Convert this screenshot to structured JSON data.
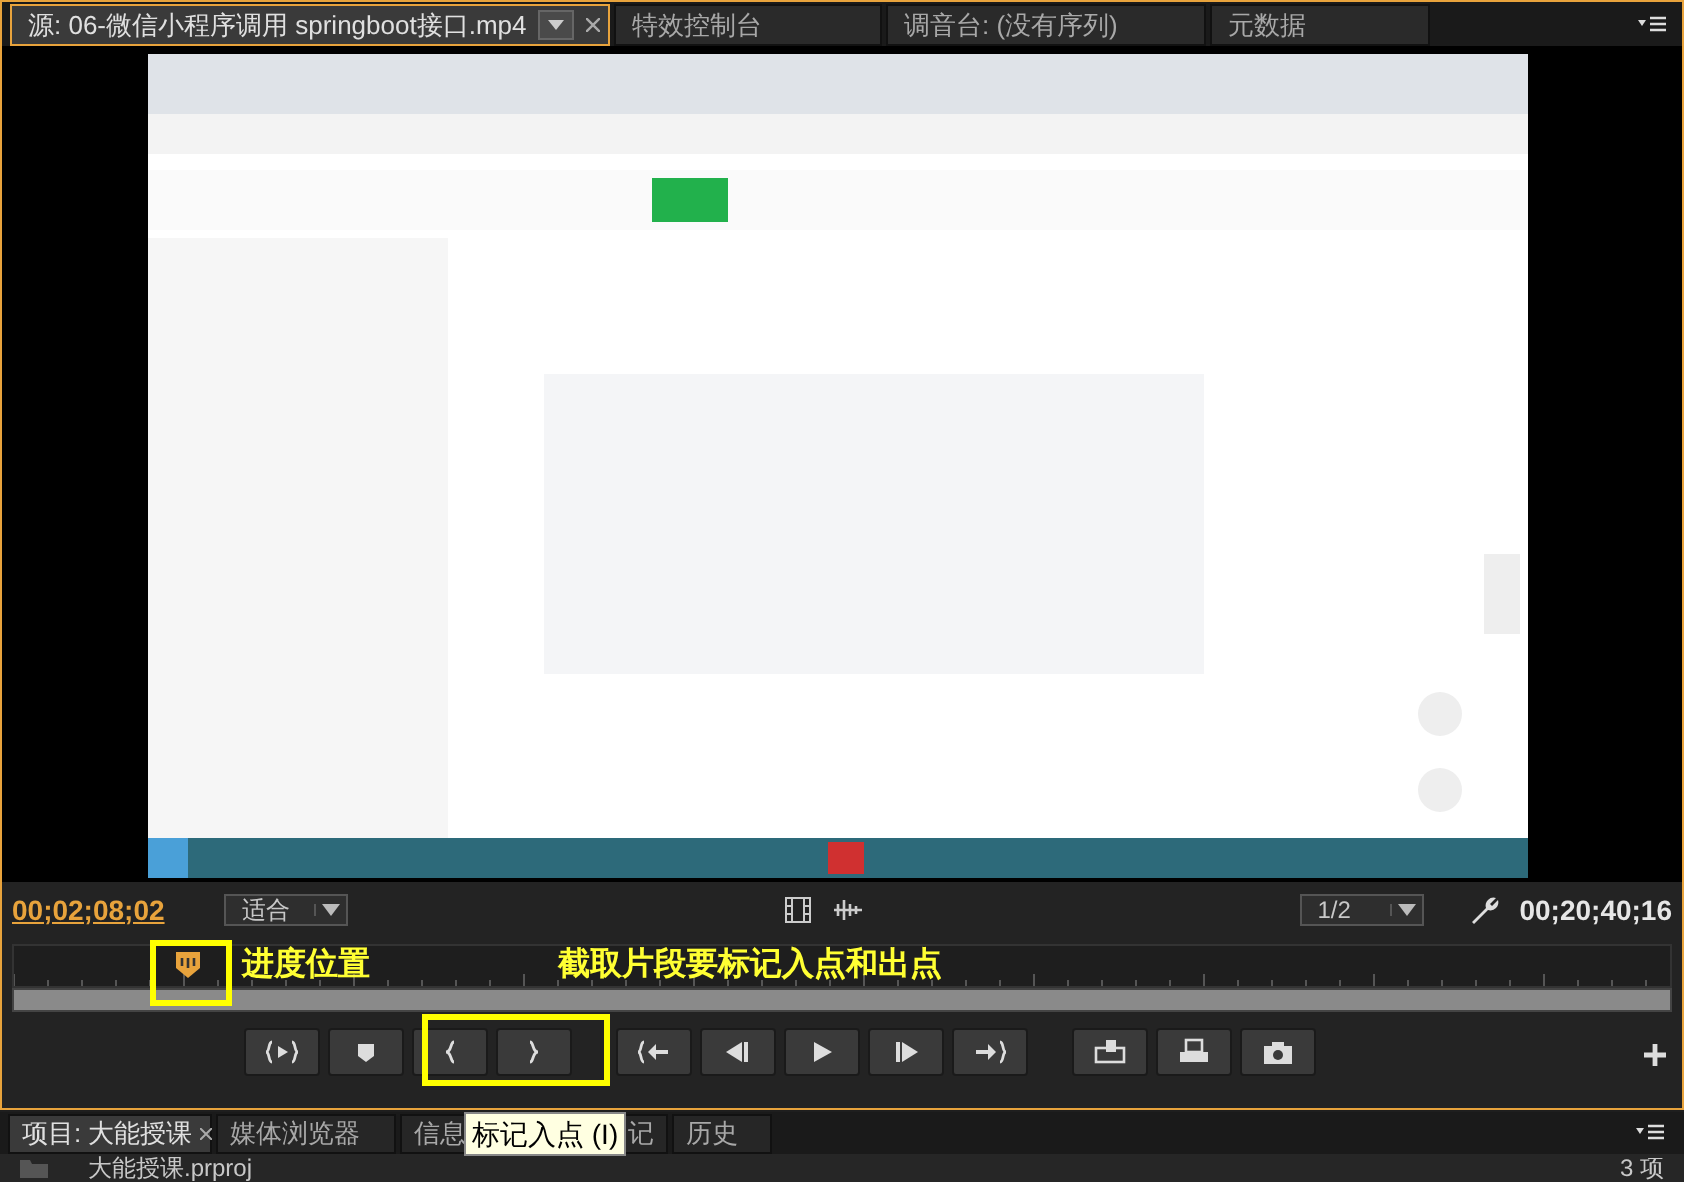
{
  "source_tabs": [
    {
      "label": "源: 06-微信小程序调用 springboot接口.mp4",
      "selected": true,
      "kind": "dropdown"
    },
    {
      "label": "特效控制台",
      "selected": false,
      "kind": "plain"
    },
    {
      "label": "调音台: (没有序列)",
      "selected": false,
      "kind": "plain"
    },
    {
      "label": "元数据",
      "selected": false,
      "kind": "plain"
    }
  ],
  "controls": {
    "current_timecode": "00;02;08;02",
    "zoom": "适合",
    "resolution": "1/2",
    "duration": "00;20;40;16"
  },
  "annotations": [
    {
      "text": "进度位置"
    },
    {
      "text": "截取片段要标记入点和出点"
    }
  ],
  "transport_buttons": [
    {
      "kind": "in-out-play"
    },
    {
      "kind": "marker"
    },
    {
      "kind": "mark-in"
    },
    {
      "kind": "mark-out"
    },
    {
      "kind": "go-in"
    },
    {
      "kind": "step-back"
    },
    {
      "kind": "play"
    },
    {
      "kind": "step-forward"
    },
    {
      "kind": "go-out"
    },
    {
      "kind": "insert"
    },
    {
      "kind": "overwrite"
    },
    {
      "kind": "export-frame"
    }
  ],
  "tooltip": "标记入点 (I)",
  "project_tabs": [
    {
      "label": "项目: 大能授课",
      "selected": true
    },
    {
      "label": "媒体浏览器",
      "selected": false
    },
    {
      "label": "信息",
      "selected": false
    },
    {
      "label": "记",
      "selected": false
    },
    {
      "label": "历史",
      "selected": false
    }
  ],
  "project": {
    "file": "大能授课.prproj",
    "count": "3 项"
  }
}
